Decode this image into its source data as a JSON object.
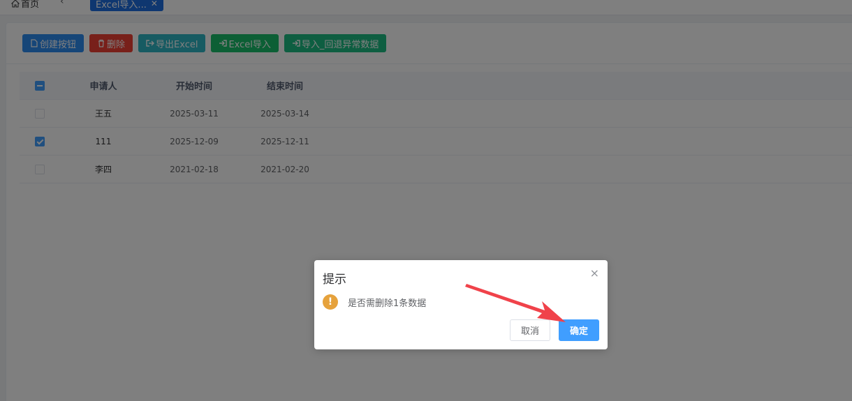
{
  "tabs": {
    "home": "首页",
    "back_icon": "chevron-left-icon",
    "active": "Excel导入...",
    "close_symbol": "✕"
  },
  "toolbar": {
    "create": "创建按钮",
    "delete": "删除",
    "export": "导出Excel",
    "import": "Excel导入",
    "import_rollback": "导入_回退异常数据"
  },
  "table": {
    "headers": [
      "申请人",
      "开始时间",
      "结束时间"
    ],
    "rows": [
      {
        "name": "王五",
        "start": "2025-03-11",
        "end": "2025-03-14",
        "checked": false
      },
      {
        "name": "111",
        "start": "2025-12-09",
        "end": "2025-12-11",
        "checked": true
      },
      {
        "name": "李四",
        "start": "2021-02-18",
        "end": "2021-02-20",
        "checked": false
      }
    ]
  },
  "dialog": {
    "title": "提示",
    "close_symbol": "×",
    "warn_symbol": "!",
    "message": "是否需删除1条数据",
    "cancel": "取消",
    "confirm": "确定"
  },
  "colors": {
    "primary": "#409eff",
    "warning": "#e6a23c",
    "annotation_arrow": "#f0424a"
  }
}
